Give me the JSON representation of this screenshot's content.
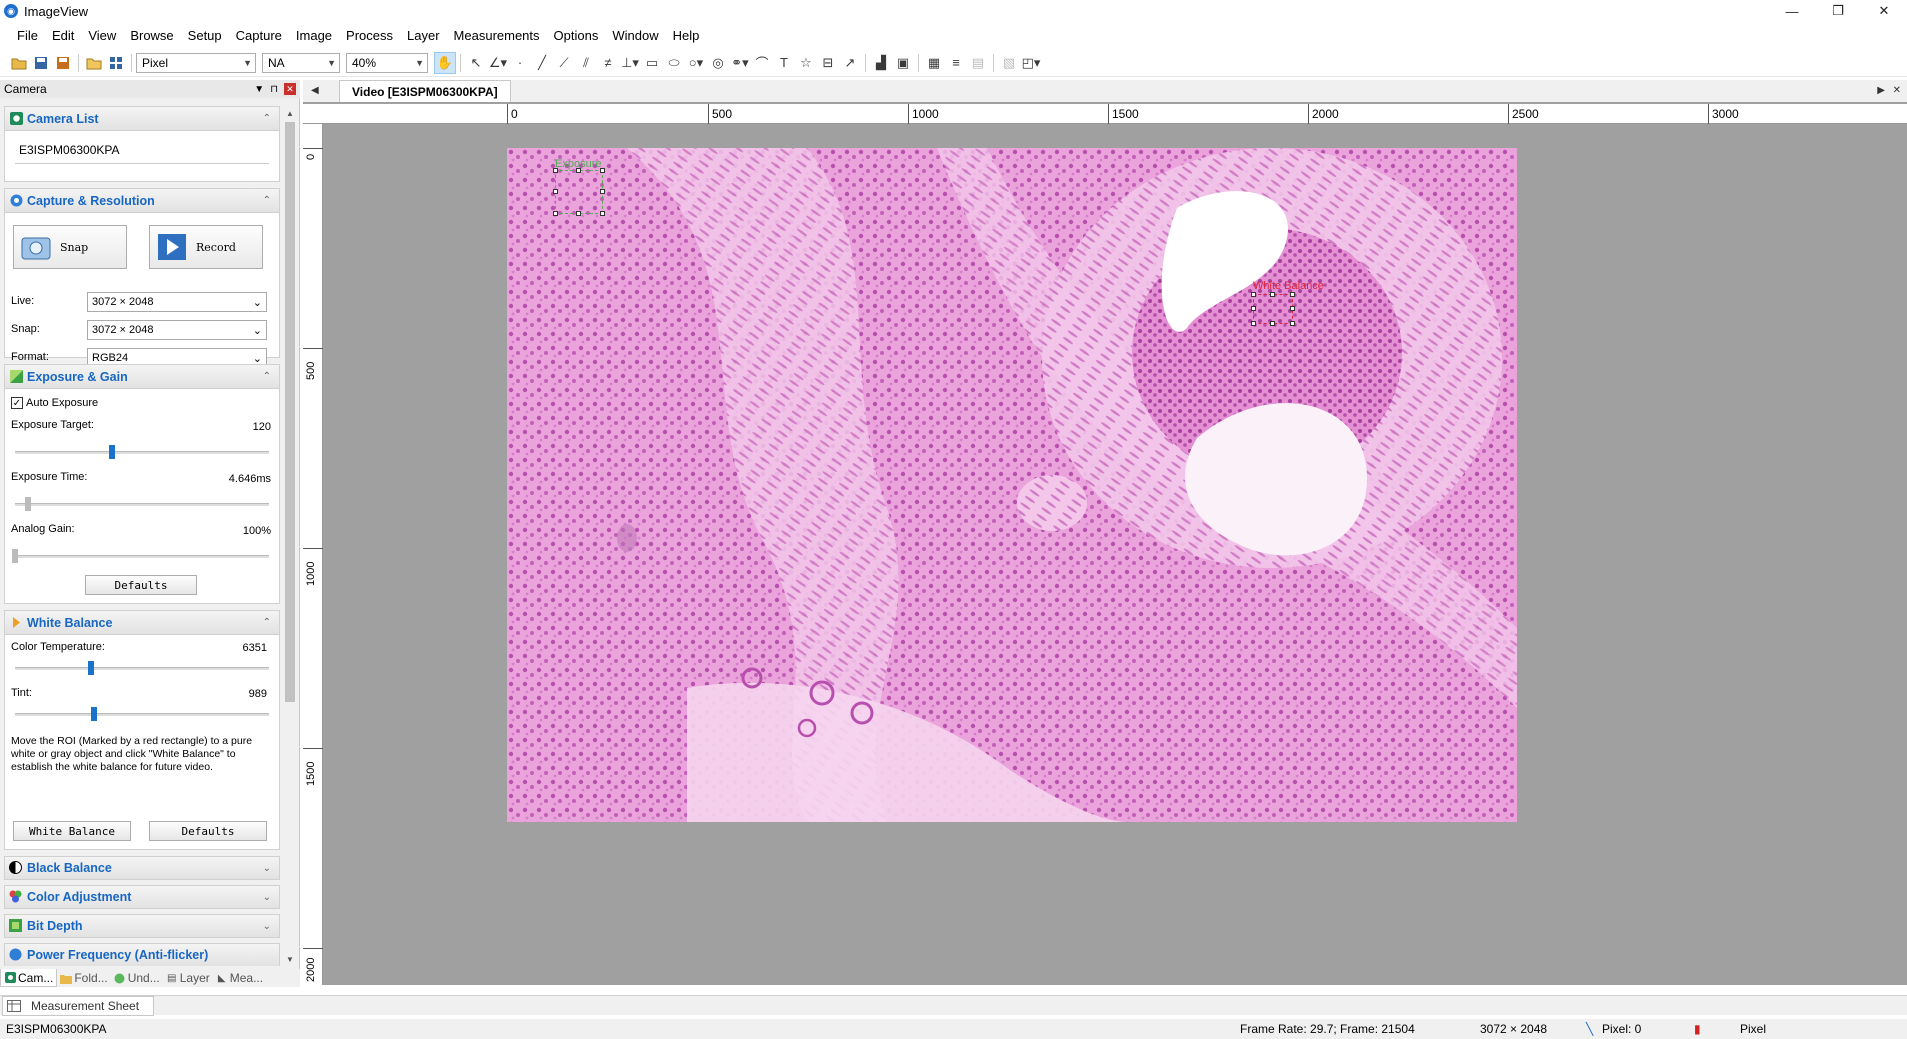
{
  "window": {
    "title": "ImageView",
    "minimize": "—",
    "restore": "❐",
    "close": "✕"
  },
  "menu": [
    "File",
    "Edit",
    "View",
    "Browse",
    "Setup",
    "Capture",
    "Image",
    "Process",
    "Layer",
    "Measurements",
    "Options",
    "Window",
    "Help"
  ],
  "toolbar": {
    "unit_select": "Pixel",
    "mag_select": "NA",
    "zoom_select": "40%"
  },
  "left_panel": {
    "title": "Camera",
    "camera_list": {
      "title": "Camera List",
      "device": "E3ISPM06300KPA"
    },
    "capture": {
      "title": "Capture & Resolution",
      "snap_label": "Snap",
      "record_label": "Record",
      "live_label": "Live:",
      "live_value": "3072 × 2048",
      "snap_field_label": "Snap:",
      "snap_value": "3072 × 2048",
      "format_label": "Format:",
      "format_value": "RGB24"
    },
    "exposure": {
      "title": "Exposure & Gain",
      "auto_label": "Auto Exposure",
      "auto_checked": true,
      "target_label": "Exposure Target:",
      "target_value": "120",
      "target_level": 0.38,
      "time_label": "Exposure Time:",
      "time_value": "4.646ms",
      "time_level": 0.05,
      "gain_label": "Analog Gain:",
      "gain_value": "100%",
      "gain_level": 0.0,
      "defaults_label": "Defaults"
    },
    "white_balance": {
      "title": "White Balance",
      "temp_label": "Color Temperature:",
      "temp_value": "6351",
      "temp_level": 0.3,
      "tint_label": "Tint:",
      "tint_value": "989",
      "tint_level": 0.31,
      "help_text": "Move the ROI (Marked by a red rectangle) to a pure white or gray object and click \"White Balance\" to establish the white balance for future video.",
      "wb_button": "White Balance",
      "defaults_label": "Defaults"
    },
    "collapsed_sections": [
      "Black Balance",
      "Color Adjustment",
      "Bit Depth",
      "Power Frequency (Anti-flicker)"
    ],
    "bottom_tabs": [
      "Cam...",
      "Fold...",
      "Und...",
      "Layer",
      "Mea..."
    ]
  },
  "document": {
    "tab_title": "Video [E3ISPM06300KPA]",
    "h_ruler_labels": [
      "0",
      "500",
      "1000",
      "1500",
      "2000",
      "2500",
      "3000"
    ],
    "v_ruler_labels": [
      "0",
      "500",
      "1000",
      "1500",
      "2000"
    ],
    "roi_exposure_label": "Exposure",
    "roi_wb_label": "White Balance"
  },
  "measurement_sheet": {
    "tab_label": "Measurement Sheet"
  },
  "status": {
    "device": "E3ISPM06300KPA",
    "frame_rate": "Frame Rate: 29.7; Frame: 21504",
    "resolution": "3072 × 2048",
    "pixel": "Pixel: 0",
    "unit": "Pixel"
  },
  "colors": {
    "accent_blue": "#1767c2",
    "slider_blue": "#1a73c9",
    "exposure_roi": "#4caf50",
    "wb_roi": "#e0233a",
    "tissue_pink": "#e89ad6"
  }
}
